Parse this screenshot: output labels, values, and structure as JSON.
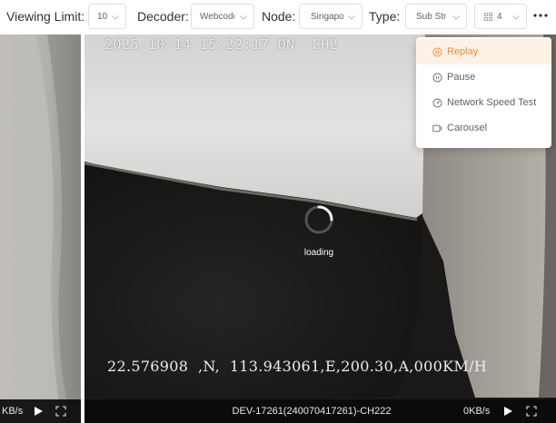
{
  "toolbar": {
    "viewing_limit_label": "Viewing Limit:",
    "viewing_limit_value": "10",
    "decoder_label": "Decoder:",
    "decoder_value": "Webcodecs",
    "node_label": "Node:",
    "node_value": "Singapore",
    "type_label": "Type:",
    "type_value": "Sub Stream",
    "layout_icon": "grid-icon",
    "layout_value": "4",
    "more_icon": "more-horizontal-icon"
  },
  "menu": {
    "items": [
      {
        "label": "Replay",
        "icon": "replay-icon",
        "active": true
      },
      {
        "label": "Pause",
        "icon": "pause-circle-icon",
        "active": false
      },
      {
        "label": "Network Speed Test",
        "icon": "speed-gauge-icon",
        "active": false
      },
      {
        "label": "Carousel",
        "icon": "carousel-icon",
        "active": false
      }
    ]
  },
  "tiles": {
    "left": {
      "rate": "KB/s",
      "play_icon": "play-icon",
      "fullscreen_icon": "fullscreen-icon"
    },
    "main": {
      "osd_timestamp": "2025-10-14 15:22:17 ON  CH2",
      "osd_gps": "22.576908  ,N,  113.943061,E,200.30,A,000KM/H",
      "loading_text": "loading",
      "device_name": "DEV-17261(240070417261)-CH222",
      "rate": "0KB/s",
      "play_icon": "play-icon",
      "fullscreen_icon": "fullscreen-icon"
    }
  },
  "colors": {
    "accent": "#f08a3c",
    "active_item_bg": "#fdf1e6",
    "control_bar": "#0a0a0a"
  }
}
